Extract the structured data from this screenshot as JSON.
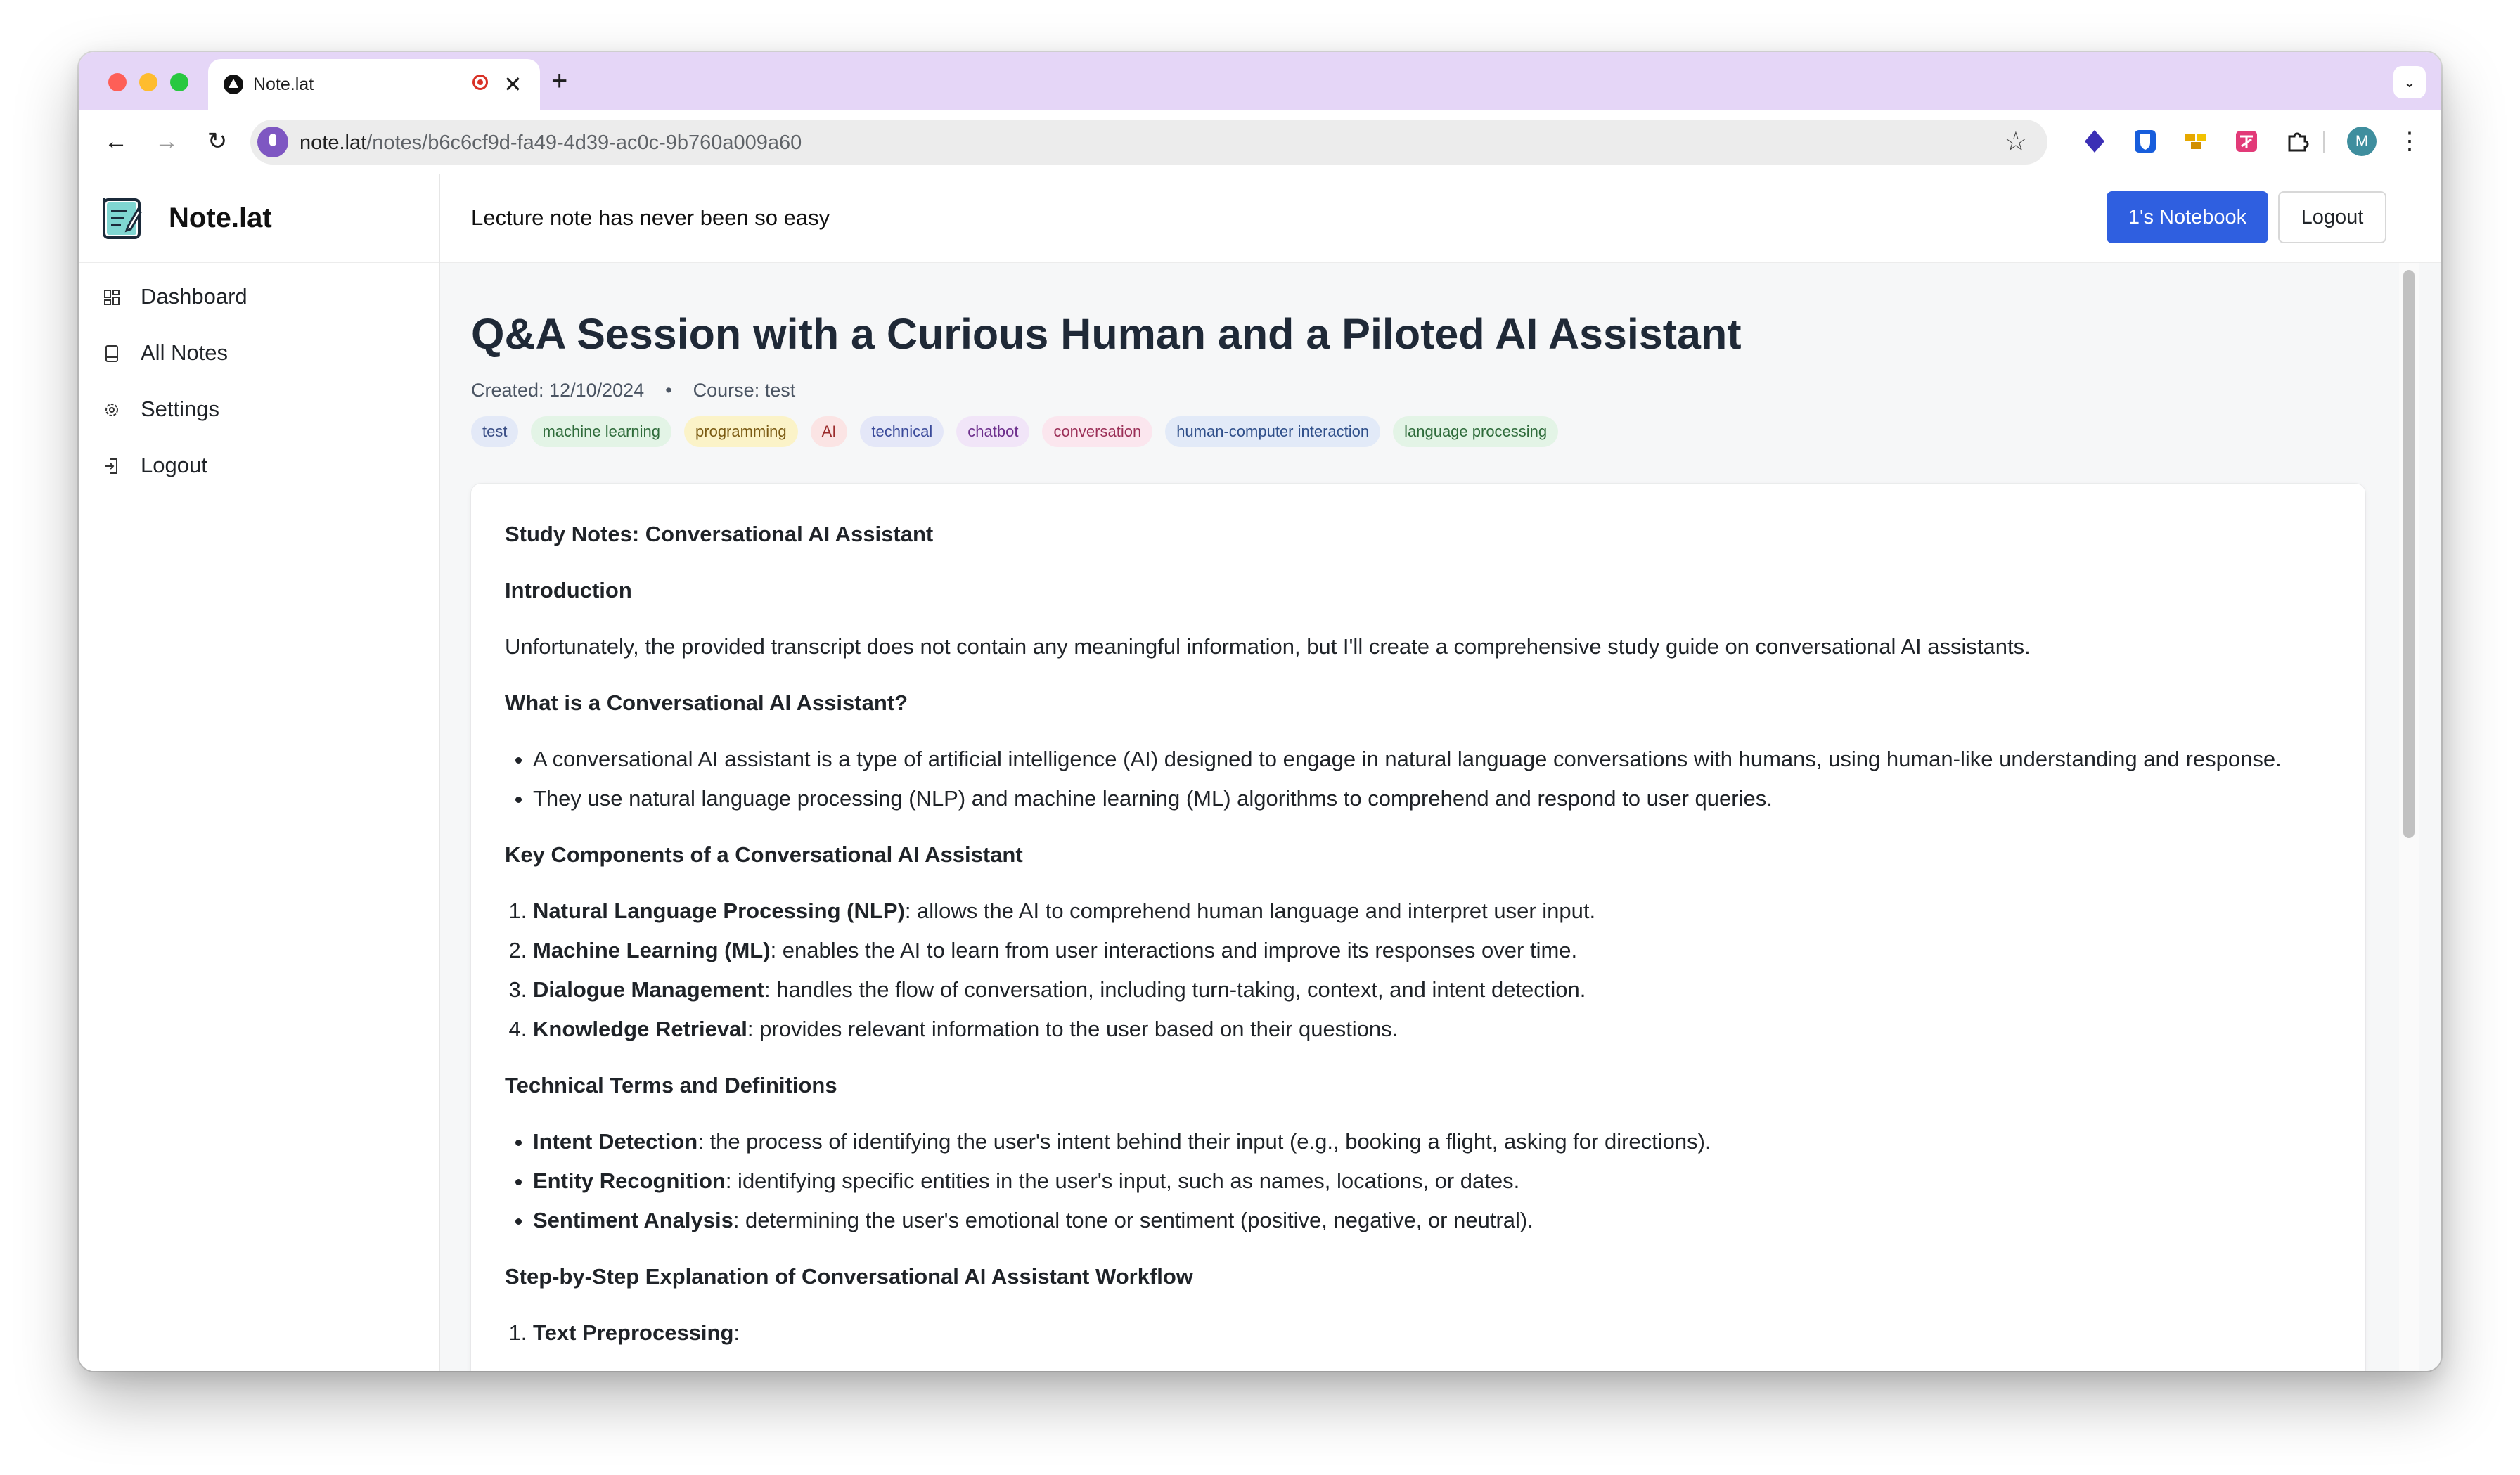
{
  "browser": {
    "tab_title": "Note.lat",
    "close_glyph": "✕",
    "newtab_glyph": "+",
    "dropdown_glyph": "⌄",
    "url_host": "note.lat",
    "url_path": "/notes/b6c6cf9d-fa49-4d39-ac0c-9b760a009a60",
    "back_glyph": "←",
    "forward_glyph": "→",
    "reload_glyph": "↻",
    "star_glyph": "☆",
    "profile_initial": "M",
    "menu_glyph": "⋮"
  },
  "sidebar": {
    "brand": "Note.lat",
    "items": [
      {
        "label": "Dashboard",
        "icon": "dashboard-icon"
      },
      {
        "label": "All Notes",
        "icon": "book-icon"
      },
      {
        "label": "Settings",
        "icon": "gear-icon"
      },
      {
        "label": "Logout",
        "icon": "logout-icon"
      }
    ]
  },
  "header": {
    "tagline": "Lecture note has never been so easy",
    "notebook_button": "1's Notebook",
    "logout_button": "Logout"
  },
  "note": {
    "title": "Q&A Session with a Curious Human and a Piloted AI Assistant",
    "created": "Created: 12/10/2024",
    "separator": "•",
    "course": "Course: test",
    "tags": [
      {
        "label": "test",
        "bg": "#e3e9f7",
        "fg": "#3b4f86"
      },
      {
        "label": "machine learning",
        "bg": "#e3f4e6",
        "fg": "#2e6b3a"
      },
      {
        "label": "programming",
        "bg": "#fbf3c8",
        "fg": "#7a5a12"
      },
      {
        "label": "AI",
        "bg": "#fbe4e4",
        "fg": "#9b2c2c"
      },
      {
        "label": "technical",
        "bg": "#e4e7f8",
        "fg": "#3a4a9a"
      },
      {
        "label": "chatbot",
        "bg": "#f1e5f8",
        "fg": "#6d2f8c"
      },
      {
        "label": "conversation",
        "bg": "#fbe6ee",
        "fg": "#9b2f57"
      },
      {
        "label": "human-computer interaction",
        "bg": "#e2eaf8",
        "fg": "#2f4f8a"
      },
      {
        "label": "language processing",
        "bg": "#e3f4e6",
        "fg": "#2e6b3a"
      }
    ],
    "body": {
      "heading": "Study Notes: Conversational AI Assistant",
      "intro_heading": "Introduction",
      "intro_text": "Unfortunately, the provided transcript does not contain any meaningful information, but I'll create a comprehensive study guide on conversational AI assistants.",
      "what_heading": "What is a Conversational AI Assistant?",
      "what_items": [
        "A conversational AI assistant is a type of artificial intelligence (AI) designed to engage in natural language conversations with humans, using human-like understanding and response.",
        "They use natural language processing (NLP) and machine learning (ML) algorithms to comprehend and respond to user queries."
      ],
      "components_heading": "Key Components of a Conversational AI Assistant",
      "components": [
        {
          "term": "Natural Language Processing (NLP)",
          "desc": ": allows the AI to comprehend human language and interpret user input."
        },
        {
          "term": "Machine Learning (ML)",
          "desc": ": enables the AI to learn from user interactions and improve its responses over time."
        },
        {
          "term": "Dialogue Management",
          "desc": ": handles the flow of conversation, including turn-taking, context, and intent detection."
        },
        {
          "term": "Knowledge Retrieval",
          "desc": ": provides relevant information to the user based on their questions."
        }
      ],
      "terms_heading": "Technical Terms and Definitions",
      "terms": [
        {
          "term": "Intent Detection",
          "desc": ": the process of identifying the user's intent behind their input (e.g., booking a flight, asking for directions)."
        },
        {
          "term": "Entity Recognition",
          "desc": ": identifying specific entities in the user's input, such as names, locations, or dates."
        },
        {
          "term": "Sentiment Analysis",
          "desc": ": determining the user's emotional tone or sentiment (positive, negative, or neutral)."
        }
      ],
      "workflow_heading": "Step-by-Step Explanation of Conversational AI Assistant Workflow",
      "workflow_first": {
        "term": "Text Preprocessing",
        "desc": ":"
      }
    }
  }
}
